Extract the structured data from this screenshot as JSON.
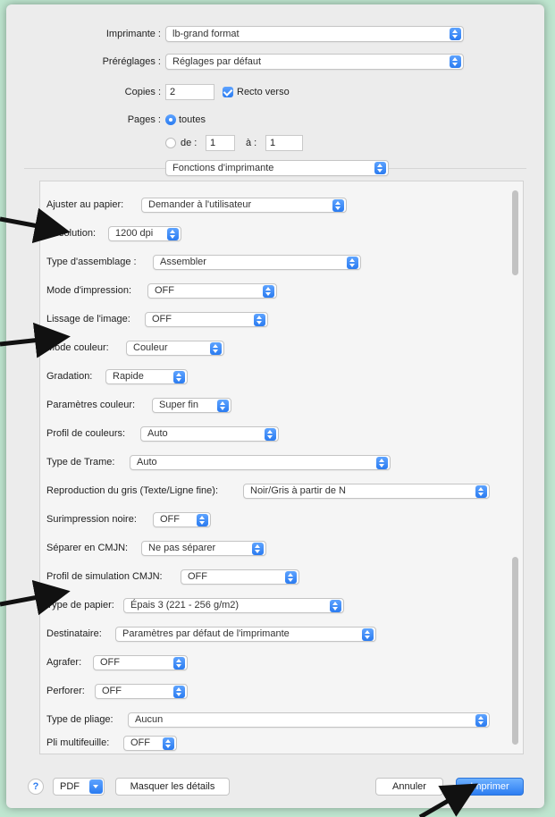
{
  "header": {
    "printer": {
      "label": "Imprimante :",
      "value": "lb-grand format"
    },
    "presets": {
      "label": "Préréglages :",
      "value": "Réglages par défaut"
    },
    "copies": {
      "label": "Copies :",
      "value": "2",
      "duplex_label": "Recto verso",
      "duplex_checked": true
    },
    "pages": {
      "label": "Pages :",
      "all_label": "toutes",
      "from_label": "de :",
      "from_value": "1",
      "to_label": "à :",
      "to_value": "1"
    },
    "section": "Fonctions d'imprimante"
  },
  "options": [
    {
      "label": "Ajuster au papier:",
      "value": "Demander à l'utilisateur"
    },
    {
      "label": "Résolution:",
      "value": "1200 dpi"
    },
    {
      "label": "Type d'assemblage :",
      "value": "Assembler"
    },
    {
      "label": "Mode d'impression:",
      "value": "OFF"
    },
    {
      "label": "Lissage de l'image:",
      "value": "OFF"
    },
    {
      "label": "Mode couleur:",
      "value": "Couleur"
    },
    {
      "label": "Gradation:",
      "value": "Rapide"
    },
    {
      "label": "Paramètres couleur:",
      "value": "Super fin"
    },
    {
      "label": "Profil de couleurs:",
      "value": "Auto"
    },
    {
      "label": "Type de Trame:",
      "value": "Auto"
    },
    {
      "label": "Reproduction du gris (Texte/Ligne fine):",
      "value": "Noir/Gris à partir de N"
    },
    {
      "label": "Surimpression noire:",
      "value": "OFF"
    },
    {
      "label": "Séparer en CMJN:",
      "value": "Ne pas séparer"
    },
    {
      "label": "Profil de simulation CMJN:",
      "value": "OFF"
    },
    {
      "label": "Type de papier:",
      "value": "Épais 3 (221 - 256 g/m2)"
    },
    {
      "label": "Destinataire:",
      "value": "Paramètres par défaut de l'imprimante"
    },
    {
      "label": "Agrafer:",
      "value": "OFF"
    },
    {
      "label": "Perforer:",
      "value": "OFF"
    },
    {
      "label": "Type de pliage:",
      "value": "Aucun"
    },
    {
      "label": "Pli multifeuille:",
      "value": "OFF"
    }
  ],
  "footer": {
    "help": "?",
    "pdf": "PDF",
    "hide_details": "Masquer les détails",
    "cancel": "Annuler",
    "print": "Imprimer"
  },
  "colors": {
    "accent": "#2a7bf0",
    "background": "#bfe6d0",
    "dialog": "#ececec"
  }
}
